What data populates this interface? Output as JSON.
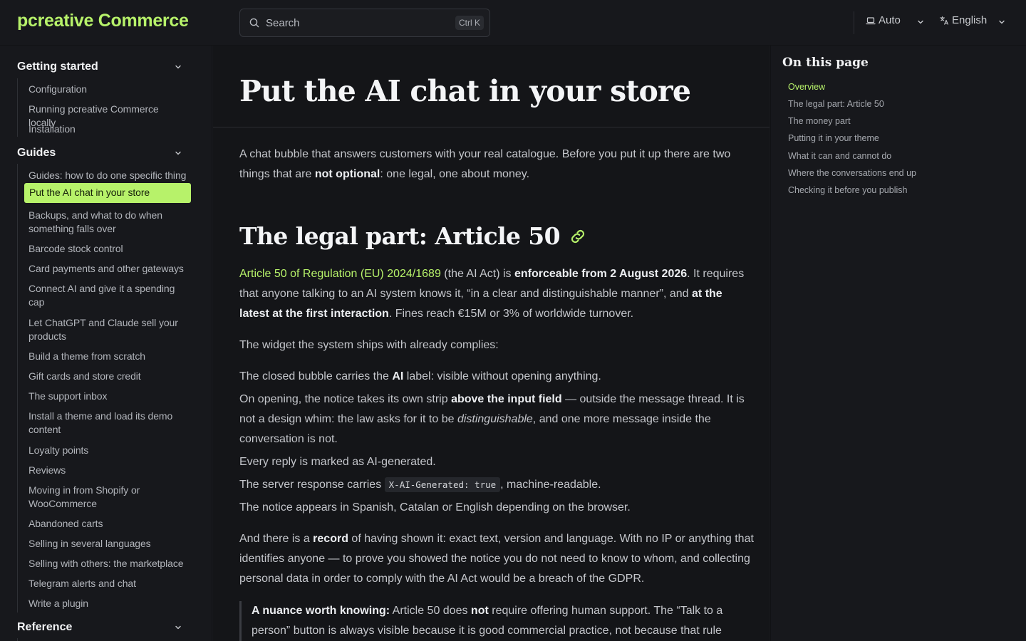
{
  "header": {
    "brand": "pcreative Commerce",
    "search_placeholder": "Search",
    "search_shortcut": "Ctrl K",
    "theme_label": "Auto",
    "language_label": "English"
  },
  "sidebar": {
    "groups": [
      {
        "title": "Getting started",
        "items": [
          "Configuration",
          "Running pcreative Commerce locally",
          "Installation"
        ]
      },
      {
        "title": "Guides",
        "items": [
          "Guides: how to do one specific thing",
          "Put the AI chat in your store",
          "Backups, and what to do when something falls over",
          "Barcode stock control",
          "Card payments and other gateways",
          "Connect AI and give it a spending cap",
          "Let ChatGPT and Claude sell your products",
          "Build a theme from scratch",
          "Gift cards and store credit",
          "The support inbox",
          "Install a theme and load its demo content",
          "Loyalty points",
          "Reviews",
          "Moving in from Shopify or WooCommerce",
          "Abandoned carts",
          "Selling in several languages",
          "Selling with others: the marketplace",
          "Telegram alerts and chat",
          "Write a plugin"
        ],
        "active": "Put the AI chat in your store"
      },
      {
        "title": "Reference",
        "items": []
      }
    ]
  },
  "main": {
    "title": "Put the AI chat in your store",
    "intro": {
      "before": "A chat bubble that answers customers with your real catalogue. Before you put it up there are two things that are ",
      "bold": "not optional",
      "after": ": one legal, one about money."
    },
    "section_heading": "The legal part: Article 50",
    "p1": {
      "link": "Article 50 of Regulation (EU) 2024/1689",
      "t1": " (the AI Act) is ",
      "b1": "enforceable from 2 August 2026",
      "t2": ". It requires that anyone talking to an AI system knows it, “in a clear and distinguishable manner”, and ",
      "b2": "at the latest at the first interaction",
      "t3": ". Fines reach €15M or 3% of worldwide turnover."
    },
    "p2": "The widget the system ships with already complies:",
    "list": {
      "l1_a": "The closed bubble carries the ",
      "l1_b": "AI",
      "l1_c": " label: visible without opening anything.",
      "l2_a": "On opening, the notice takes its own strip ",
      "l2_b": "above the input field",
      "l2_c": " — outside the message thread. It is not a design whim: the law asks for it to be ",
      "l2_d": "distinguishable",
      "l2_e": ", and one more message inside the conversation is not.",
      "l3": "Every reply is marked as AI-generated.",
      "l4_a": "The server response carries ",
      "l4_code": "X-AI-Generated: true",
      "l4_b": ", machine-readable.",
      "l5": "The notice appears in Spanish, Catalan or English depending on the browser."
    },
    "p3": {
      "a": "And there is a ",
      "b": "record",
      "c": " of having shown it: exact text, version and language. With no IP or anything that identifies anyone — to prove you showed the notice you do not need to know to whom, and collecting personal data in order to comply with the AI Act would be a breach of the GDPR."
    },
    "note": {
      "b1": "A nuance worth knowing:",
      "t1": " Article 50 does ",
      "b2": "not",
      "t2": " require offering human support. The “Talk to a person” button is always visible because it is good commercial practice, not because that rule mandates it. Do"
    }
  },
  "toc": {
    "title": "On this page",
    "items": [
      "Overview",
      "The legal part: Article 50",
      "The money part",
      "Putting it in your theme",
      "What it can and cannot do",
      "Where the conversations end up",
      "Checking it before you publish"
    ],
    "current": "Overview"
  },
  "colors": {
    "accent": "#b7f26a",
    "background": "#17181c",
    "content_background": "#141518"
  }
}
